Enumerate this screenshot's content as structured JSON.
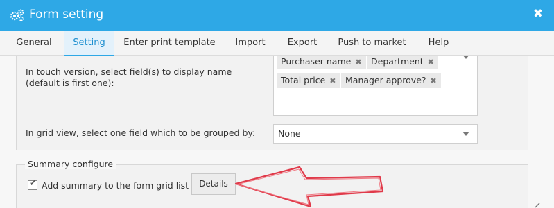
{
  "window": {
    "title": "Form setting",
    "icon": "gears-icon",
    "close_glyph": "✖"
  },
  "tabs": [
    {
      "label": "General"
    },
    {
      "label": "Setting"
    },
    {
      "label": "Enter print template"
    },
    {
      "label": "Import"
    },
    {
      "label": "Export"
    },
    {
      "label": "Push to market"
    },
    {
      "label": "Help"
    }
  ],
  "active_tab": "Setting",
  "touch_section": {
    "label": "In touch version, select field(s) to display name (default is first one):",
    "tags": [
      {
        "label": "Purchaser name",
        "remove": "✖"
      },
      {
        "label": "Department",
        "remove": "✖"
      },
      {
        "label": "Total price",
        "remove": "✖"
      },
      {
        "label": "Manager approve?",
        "remove": "✖"
      }
    ]
  },
  "grid_section": {
    "label": "In grid view, select one field which to be grouped by:",
    "selected": "None"
  },
  "summary": {
    "legend": "Summary configure",
    "checkbox_label": "Add summary to the form grid list",
    "checked": true,
    "details_button": "Details"
  },
  "colors": {
    "titlebar": "#2ea8e6",
    "active_tab_text": "#1f90d0",
    "annotation_arrow": "#e03a4a"
  }
}
